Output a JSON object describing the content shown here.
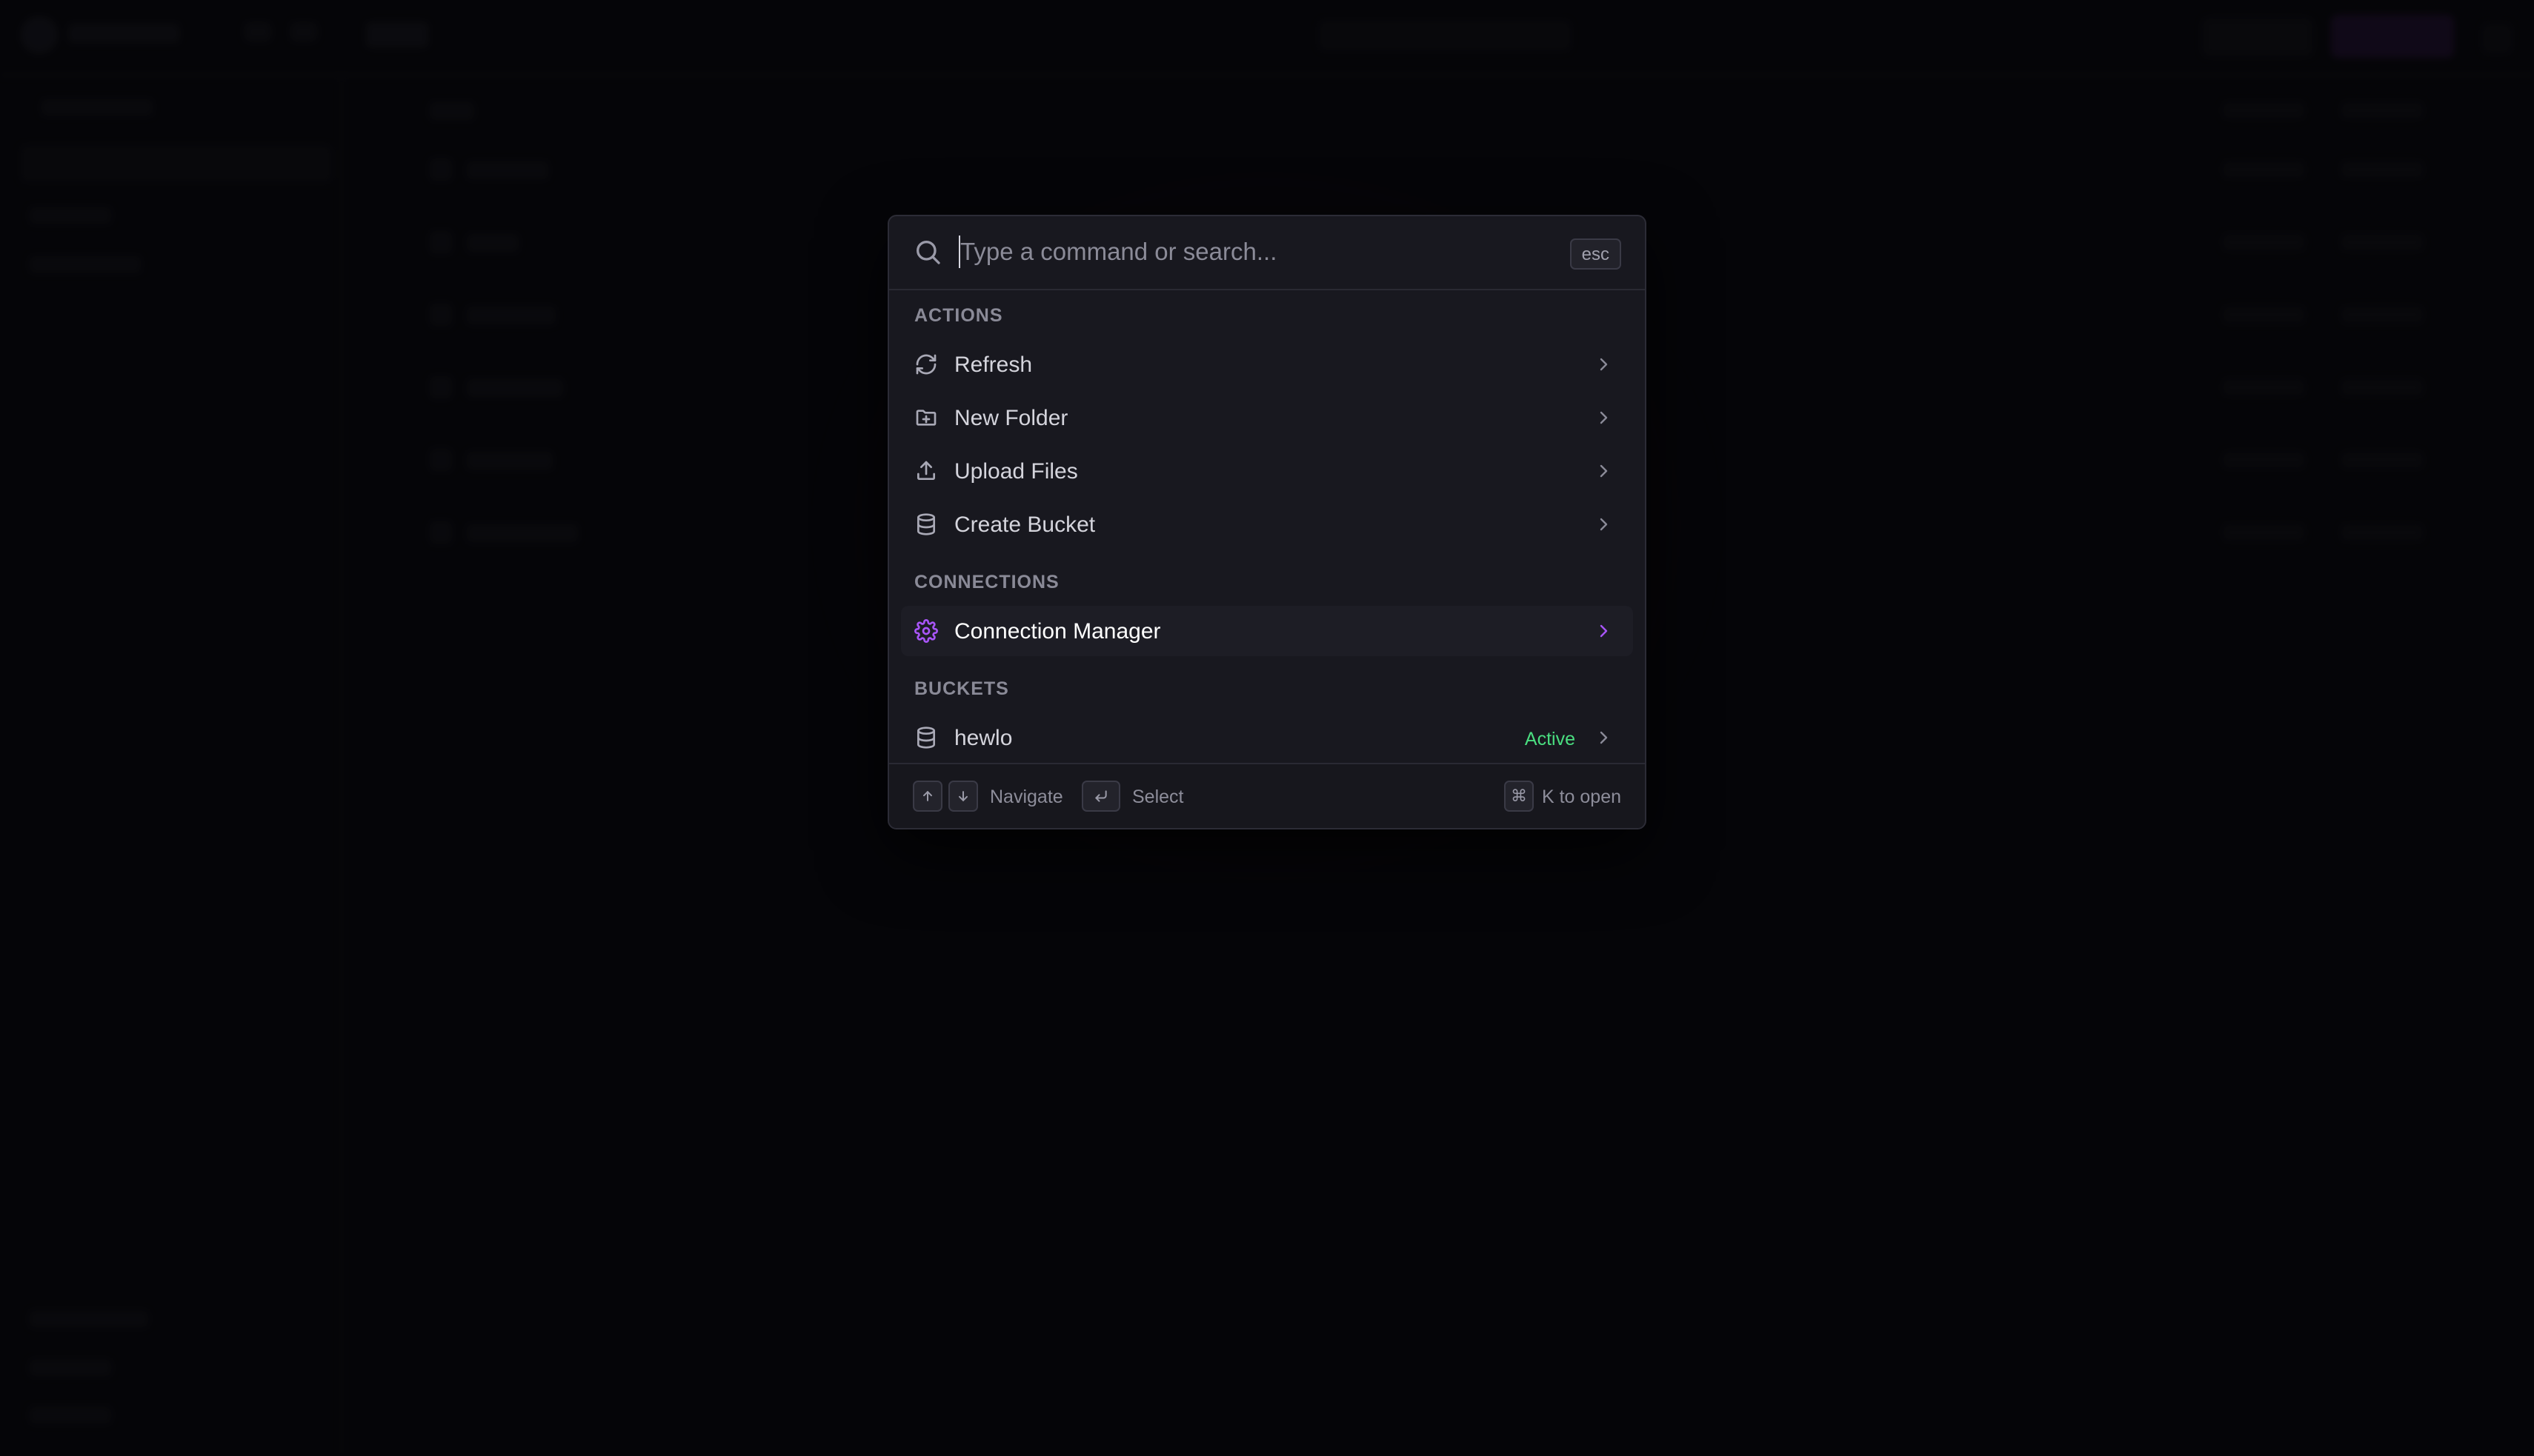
{
  "search": {
    "placeholder": "Type a command or search...",
    "value": "",
    "esc_label": "esc"
  },
  "groups": [
    {
      "label": "ACTIONS",
      "items": [
        {
          "label": "Refresh",
          "icon": "refresh-icon"
        },
        {
          "label": "New Folder",
          "icon": "folder-plus-icon"
        },
        {
          "label": "Upload Files",
          "icon": "upload-icon"
        },
        {
          "label": "Create Bucket",
          "icon": "database-icon"
        }
      ]
    },
    {
      "label": "CONNECTIONS",
      "items": [
        {
          "label": "Connection Manager",
          "icon": "gear-icon",
          "selected": true
        }
      ]
    },
    {
      "label": "BUCKETS",
      "items": [
        {
          "label": "hewlo",
          "icon": "database-icon",
          "status": "Active"
        }
      ]
    }
  ],
  "footer": {
    "navigate_label": "Navigate",
    "select_label": "Select",
    "open_key": "⌘",
    "open_label": "K to open"
  },
  "colors": {
    "accent": "#a855f7",
    "active_status": "#4ade80",
    "palette_bg": "#18181f",
    "backdrop": "#07070a"
  }
}
